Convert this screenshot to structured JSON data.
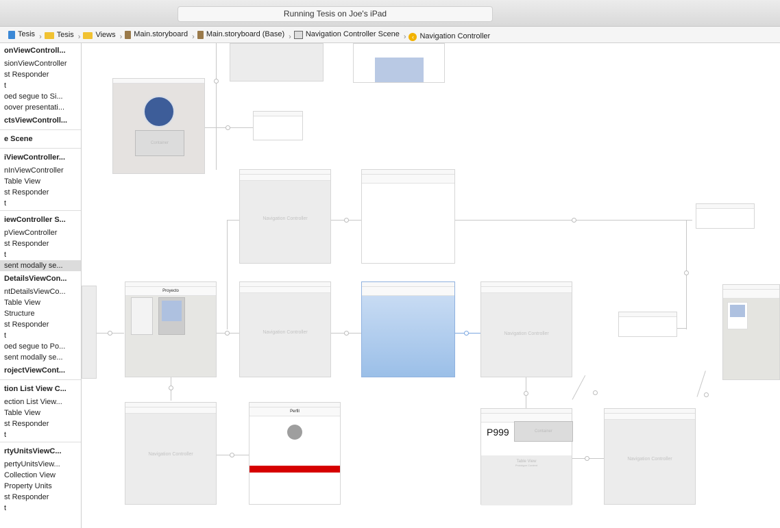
{
  "toolbar": {
    "status": "Running Tesis on Joe's iPad"
  },
  "breadcrumbs": [
    {
      "label": "Tesis",
      "icon": "file-icon"
    },
    {
      "label": "Tesis",
      "icon": "folder-icon"
    },
    {
      "label": "Views",
      "icon": "folder-icon"
    },
    {
      "label": "Main.storyboard",
      "icon": "storyboard-icon"
    },
    {
      "label": "Main.storyboard (Base)",
      "icon": "storyboard-icon"
    },
    {
      "label": "Navigation Controller Scene",
      "icon": "scene-icon"
    },
    {
      "label": "Navigation Controller",
      "icon": "nav-controller-icon"
    }
  ],
  "outline": [
    {
      "t": "onViewControll...",
      "head": true
    },
    {
      "t": "sionViewController"
    },
    {
      "t": "st Responder"
    },
    {
      "t": "t"
    },
    {
      "t": "oed segue to Si..."
    },
    {
      "t": "oover presentati..."
    },
    {
      "t": "ctsViewControll...",
      "head": true
    },
    {
      "t": "",
      "div": true
    },
    {
      "t": "e Scene",
      "head": true
    },
    {
      "t": "",
      "div": true
    },
    {
      "t": "iViewController...",
      "head": true
    },
    {
      "t": "nInViewController"
    },
    {
      "t": "Table View"
    },
    {
      "t": "st Responder"
    },
    {
      "t": "t"
    },
    {
      "t": "",
      "div": true
    },
    {
      "t": "iewController S...",
      "head": true
    },
    {
      "t": "pViewController"
    },
    {
      "t": "st Responder"
    },
    {
      "t": "t"
    },
    {
      "t": "sent modally se...",
      "sel": true
    },
    {
      "t": "DetailsViewCon...",
      "head": true
    },
    {
      "t": "ntDetailsViewCo..."
    },
    {
      "t": "Table View"
    },
    {
      "t": "Structure"
    },
    {
      "t": "st Responder"
    },
    {
      "t": "t"
    },
    {
      "t": "oed segue to Po..."
    },
    {
      "t": "sent modally se..."
    },
    {
      "t": "rojectViewCont...",
      "head": true
    },
    {
      "t": "",
      "div": true
    },
    {
      "t": "tion List View C...",
      "head": true
    },
    {
      "t": "ection List View..."
    },
    {
      "t": "Table View"
    },
    {
      "t": "st Responder"
    },
    {
      "t": "t"
    },
    {
      "t": "",
      "div": true
    },
    {
      "t": "rtyUnitsViewC...",
      "head": true
    },
    {
      "t": "pertyUnitsView..."
    },
    {
      "t": "Collection View"
    },
    {
      "t": "Property Units"
    },
    {
      "t": "st Responder"
    },
    {
      "t": "t"
    }
  ],
  "canvas": {
    "nav_controller_label": "Navigation Controller",
    "container_label": "Container",
    "table_view_label": "Table View",
    "prototype_label": "Prototype Content",
    "p999": "P999",
    "projects_title": "Proyecto",
    "profile_title": "Perfil"
  }
}
